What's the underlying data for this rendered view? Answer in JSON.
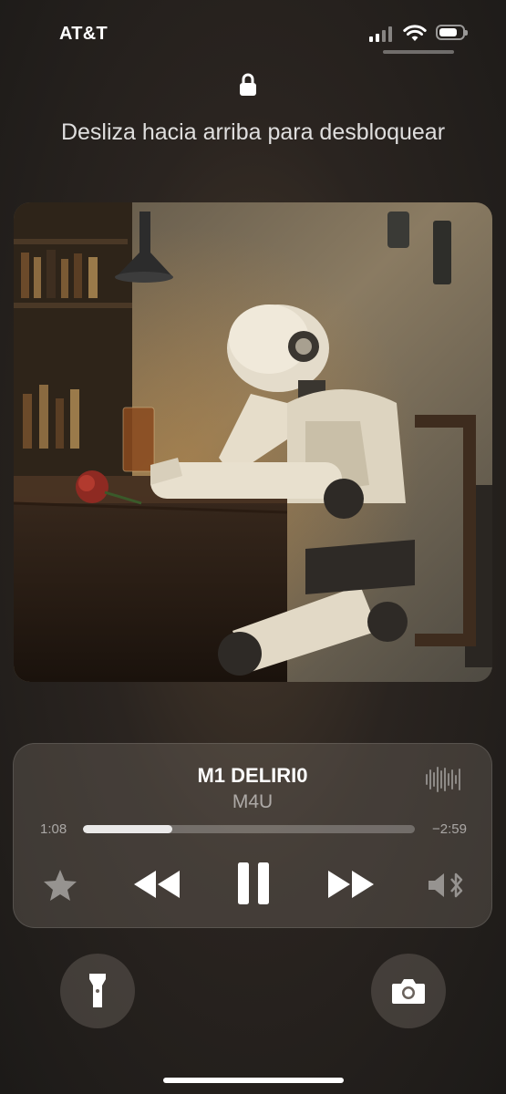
{
  "status_bar": {
    "carrier": "AT&T"
  },
  "lock_screen": {
    "unlock_hint": "Desliza hacia arriba para desbloquear"
  },
  "now_playing": {
    "title": "M1 DELIRI0",
    "artist": "M4U",
    "elapsed": "1:08",
    "remaining": "−2:59",
    "progress": 0.27
  },
  "icons": {
    "lock": "lock-icon",
    "favorite": "star-icon",
    "rewind": "rewind-icon",
    "pause": "pause-icon",
    "fast_forward": "fast-forward-icon",
    "audio_output": "speaker-bluetooth-icon",
    "waveform": "waveform-icon",
    "flashlight": "flashlight-icon",
    "camera": "camera-icon"
  }
}
